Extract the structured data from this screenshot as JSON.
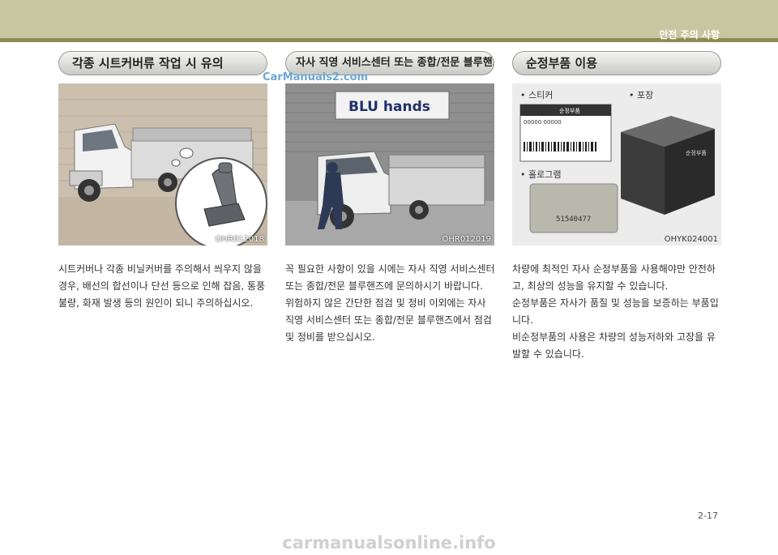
{
  "header": {
    "section": "안전 주의 사항"
  },
  "watermark_top": "CarManuals2.com",
  "columns": [
    {
      "title": "각종 시트커버류 작업 시 유의",
      "image_code": "OHR012018",
      "text": "시트커버나 각종 비닐커버를 주의해서 씌우지 않을경우, 배선의 합선이나 단선 등으로 인해 잡음, 통풍불량, 화재 발생 등의 원인이 되니 주의하십시오."
    },
    {
      "title": "자사 직영 서비스센터 또는 종합/전문 블루핸즈 이용",
      "image_code": "OHR012019",
      "sign": "BLU hands",
      "paragraphs": [
        "꼭 필요한 사항이 있을 시에는 자사 직영 서비스센터 또는 종합/전문 블루핸즈에 문의하시기 바랍니다.",
        "위험하지 않은 간단한 점검 및 정비 이외에는 자사 직영 서비스센터 또는 종합/전문 블루핸즈에서 점검 및 정비를 받으십시오."
      ]
    },
    {
      "title": "순정부품 이용",
      "image_code": "OHYK024001",
      "labels": {
        "sticker": "• 스티커",
        "package": "• 포장",
        "hologram": "• 홀로그램"
      },
      "sticker_text": {
        "brand": "순정부품",
        "part_no": "00000 00000"
      },
      "box_text": "순정부품",
      "hologram_number": "51540477",
      "paragraphs": [
        "차량에 최적인 자사 순정부품을 사용해야만 안전하고, 최상의 성능을 유지할 수 있습니다.",
        "순정부품은 자사가 품질 및 성능을 보증하는 부품입니다.",
        "비순정부품의 사용은 차량의 성능저하와 고장을 유발할 수 있습니다."
      ]
    }
  ],
  "page_number": "2-17",
  "watermark_bottom": "carmanualsonline.info"
}
